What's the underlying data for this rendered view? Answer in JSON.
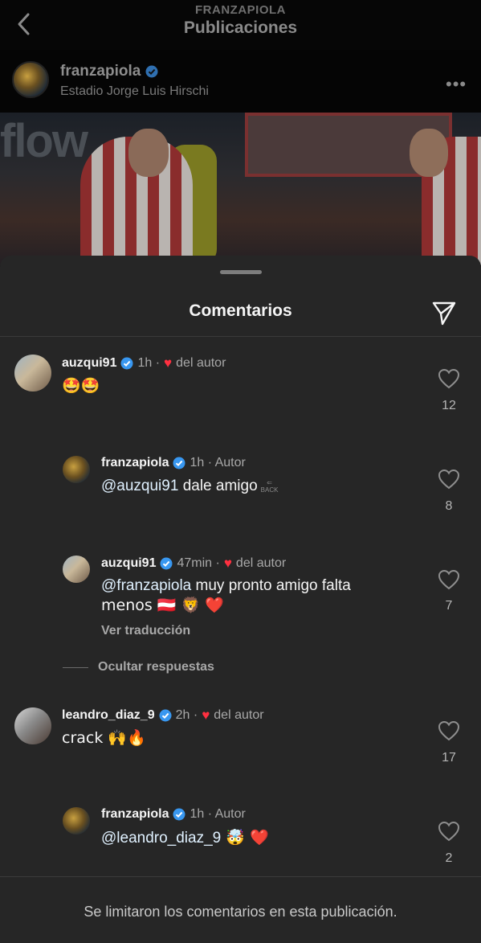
{
  "header": {
    "account": "FRANZAPIOLA",
    "title": "Publicaciones"
  },
  "post": {
    "username": "franzapiola",
    "location": "Estadio Jorge Luis Hirschi",
    "photo_text": "flow",
    "more_label": "•••"
  },
  "sheet": {
    "title": "Comentarios",
    "see_translation": "Ver traducción",
    "hide_replies": "Ocultar respuestas",
    "limited_notice": "Se limitaron los comentarios en esta publicación."
  },
  "comments": [
    {
      "user": "auzqui91",
      "time": "1h ·",
      "liked_by_author": "del autor",
      "text": "🤩🤩",
      "likes": "12"
    },
    {
      "user": "franzapiola",
      "time": "1h · Autor",
      "mention": "@auzqui91",
      "text": " dale amigo",
      "likes": "8",
      "back_label": "BACK"
    },
    {
      "user": "auzqui91",
      "time": "47min ·",
      "liked_by_author": "del autor",
      "mention": "@franzapiola",
      "text": " muy pronto amigo falta",
      "text2": "menos 🇦🇹 🦁 ❤️",
      "likes": "7"
    },
    {
      "user": "leandro_diaz_9",
      "time": "2h ·",
      "liked_by_author": "del autor",
      "text": "crack 🙌🔥",
      "likes": "17"
    },
    {
      "user": "franzapiola",
      "time": "1h · Autor",
      "mention": "@leandro_diaz_9",
      "text": " 🤯 ❤️",
      "likes": "2"
    }
  ],
  "colors": {
    "background": "#000000",
    "sheet": "#262626",
    "verified_blue": "#3897f0",
    "like_red": "#ff3040"
  },
  "icons": [
    "chevron-left-icon",
    "verified-badge-icon",
    "more-icon",
    "send-icon",
    "heart-outline-icon",
    "heart-filled-icon"
  ]
}
